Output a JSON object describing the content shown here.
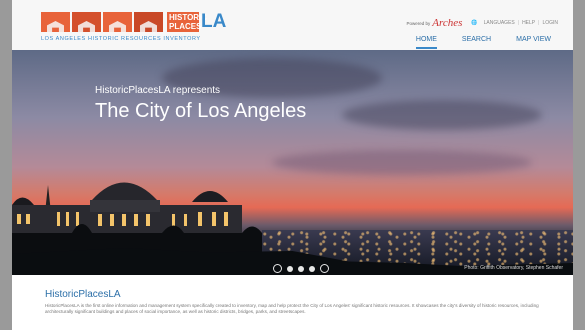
{
  "header": {
    "logo_word": "HISTORIC PLACES",
    "logo_la": "LA",
    "logo_sub": "LOS ANGELES HISTORIC RESOURCES INVENTORY",
    "powered_by": "Powered by",
    "arches": "Arches",
    "languages": "LANGUAGES",
    "help": "HELP",
    "login": "LOGIN"
  },
  "nav": [
    {
      "label": "HOME",
      "active": true
    },
    {
      "label": "SEARCH",
      "active": false
    },
    {
      "label": "MAP VIEW",
      "active": false
    }
  ],
  "hero": {
    "kicker": "HistoricPlacesLA represents",
    "title": "The City of Los Angeles",
    "credit": "Photo: Griffith Observatory, Stephen Schafer",
    "slides": 5,
    "active_slide": 1
  },
  "intro": {
    "title": "HistoricPlacesLA",
    "body": "HistoricPlacesLA is the first online information and management system specifically created to inventory, map and help protect the City of Los Angeles' significant historic resources. It showcases the city's diversity of historic resources, including architecturally significant buildings and places of social importance, as well as historic districts, bridges, parks, and streetscapes."
  }
}
